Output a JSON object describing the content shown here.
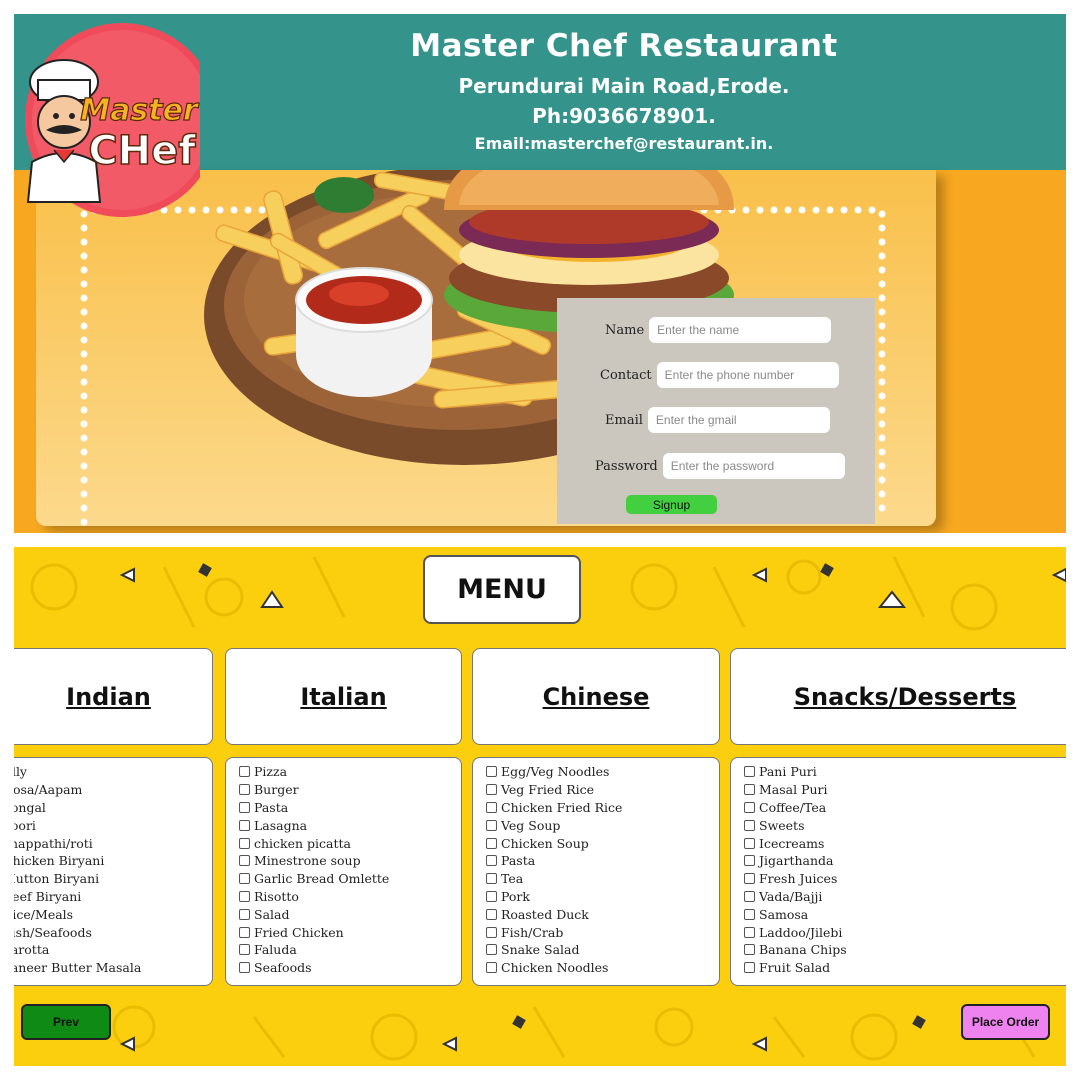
{
  "header": {
    "title": "Master Chef Restaurant",
    "address": "Perundurai Main Road,Erode.",
    "phone": "Ph:9036678901.",
    "email": "Email:masterchef@restaurant.in."
  },
  "logo": {
    "line1": "Master",
    "line2": "CHef"
  },
  "signup": {
    "name_label": "Name",
    "name_placeholder": "Enter the name",
    "contact_label": "Contact",
    "contact_placeholder": "Enter the phone number",
    "email_label": "Email",
    "email_placeholder": "Enter the gmail",
    "password_label": "Password",
    "password_placeholder": "Enter the password",
    "button": "Signup"
  },
  "menu": {
    "title": "MENU",
    "categories": [
      {
        "name": "Indian",
        "items": [
          "Idly",
          "Dosa/Aapam",
          "Pongal",
          "Poori",
          "chappathi/roti",
          "Chicken Biryani",
          "Mutton Biryani",
          "Beef Biryani",
          "Rice/Meals",
          "Fish/Seafoods",
          "Parotta",
          "Paneer Butter Masala"
        ]
      },
      {
        "name": "Italian",
        "items": [
          "Pizza",
          "Burger",
          "Pasta",
          "Lasagna",
          "chicken picatta",
          "Minestrone soup",
          "Garlic Bread Omlette",
          "Risotto",
          "Salad",
          "Fried Chicken",
          "Faluda",
          "Seafoods"
        ]
      },
      {
        "name": "Chinese",
        "items": [
          "Egg/Veg Noodles",
          "Veg Fried Rice",
          "Chicken Fried Rice",
          "Veg Soup",
          "Chicken Soup",
          "Pasta",
          "Tea",
          "Pork",
          "Roasted Duck",
          "Fish/Crab",
          "Snake Salad",
          "Chicken Noodles"
        ]
      },
      {
        "name": "Snacks/Desserts",
        "items": [
          "Pani Puri",
          "Masal Puri",
          "Coffee/Tea",
          "Sweets",
          "Icecreams",
          "Jigarthanda",
          "Fresh Juices",
          "Vada/Bajji",
          "Samosa",
          "Laddoo/Jilebi",
          "Banana Chips",
          "Fruit Salad"
        ]
      }
    ]
  },
  "buttons": {
    "prev": "Prev",
    "place_order": "Place Order"
  },
  "colors": {
    "header": "#34948b",
    "background_orange": "#f7a820",
    "menu_yellow": "#fbcf0e",
    "signup_green": "#43d040",
    "prev_green": "#0f8a14",
    "order_pink": "#ee82ee"
  }
}
